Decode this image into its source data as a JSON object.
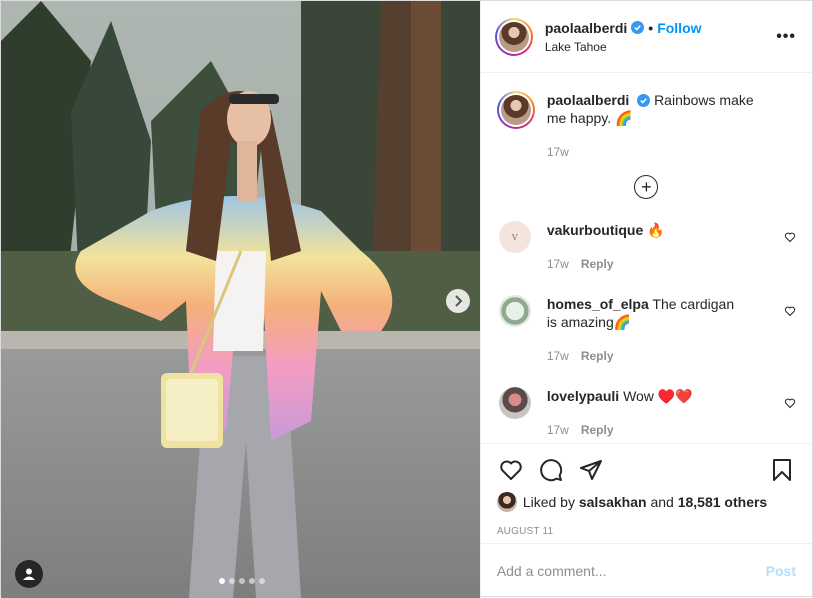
{
  "header": {
    "username": "paolaalberdi",
    "separator": "•",
    "follow_label": "Follow",
    "location": "Lake Tahoe",
    "more_label": "•••"
  },
  "caption": {
    "username": "paolaalberdi",
    "text": "Rainbows make me happy. 🌈",
    "time": "17w"
  },
  "comments": [
    {
      "username": "vakurboutique",
      "text": "🔥",
      "time": "17w",
      "reply_label": "Reply",
      "avatar_color": "#f4e4dc"
    },
    {
      "username": "homes_of_elpa",
      "text": "The cardigan is amazing🌈",
      "time": "17w",
      "reply_label": "Reply",
      "avatar_color": "#dfe7df"
    },
    {
      "username": "lovelypauli",
      "text": "Wow ♥️❤️",
      "time": "17w",
      "reply_label": "Reply",
      "avatar_color": "#c9c4c4"
    }
  ],
  "likes": {
    "prefix": "Liked by",
    "user": "salsakhan",
    "middle": "and",
    "count": "18,581 others"
  },
  "date": "AUGUST 11",
  "add_comment": {
    "placeholder": "Add a comment...",
    "post_label": "Post"
  },
  "carousel": {
    "total_slides": 5,
    "active_slide": 1
  },
  "colors": {
    "link": "#0095f6",
    "post_disabled": "#b2dffc",
    "muted": "#8e8e8e"
  }
}
